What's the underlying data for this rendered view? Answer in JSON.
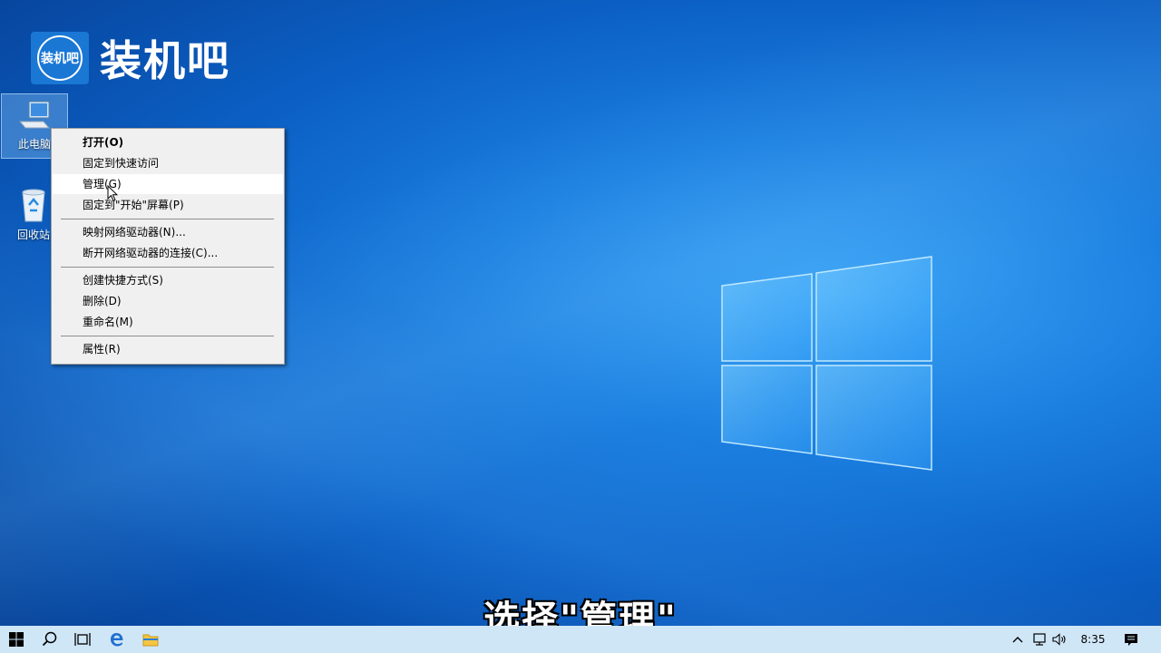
{
  "brand": {
    "badge_text": "装机吧",
    "name": "装机吧"
  },
  "desktop": {
    "icons": [
      {
        "label": "此电脑",
        "icon": "computer-icon"
      },
      {
        "label": "回收站",
        "icon": "recycle-bin-icon"
      }
    ]
  },
  "context_menu": {
    "items": [
      {
        "label": "打开(O)",
        "bold": true
      },
      {
        "label": "固定到快速访问"
      },
      {
        "label": "管理(G)",
        "highlighted": true
      },
      {
        "label": "固定到\"开始\"屏幕(P)"
      },
      {
        "label": "映射网络驱动器(N)..."
      },
      {
        "label": "断开网络驱动器的连接(C)..."
      },
      {
        "label": "创建快捷方式(S)"
      },
      {
        "label": "删除(D)"
      },
      {
        "label": "重命名(M)"
      },
      {
        "label": "属性(R)"
      }
    ]
  },
  "subtitle": "选择\"管理\"",
  "taskbar": {
    "icons": [
      "windows-start-icon",
      "search-icon",
      "task-view-icon",
      "edge-icon",
      "file-explorer-icon"
    ],
    "tray_icons": [
      "chevron-up-icon",
      "network-icon",
      "volume-icon",
      "notification-icon"
    ],
    "clock": "8:35"
  },
  "colors": {
    "accent": "#0b5fc4",
    "taskbar": "#cfe6f7",
    "menu_bg": "#f0f0f0"
  }
}
